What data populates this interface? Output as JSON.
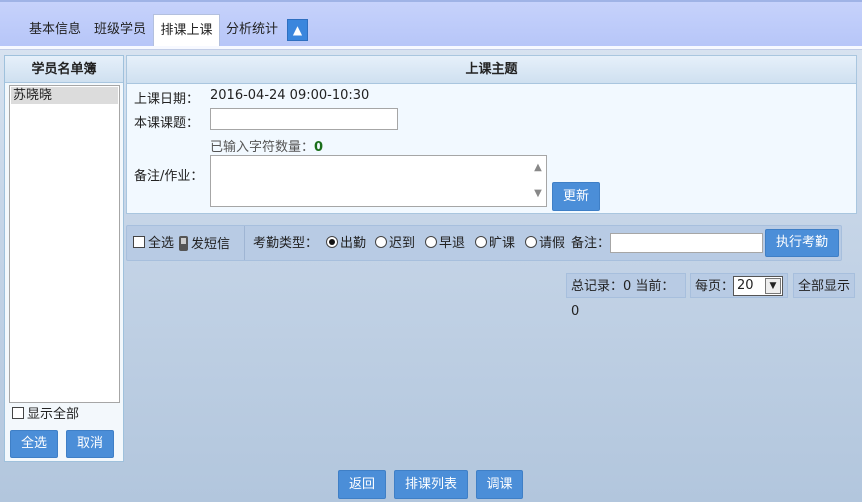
{
  "tabs": [
    {
      "label": "基本信息"
    },
    {
      "label": "班级学员"
    },
    {
      "label": "排课上课"
    },
    {
      "label": "分析统计"
    }
  ],
  "collapse_icon": "▲",
  "students_panel": {
    "title": "学员名单簿",
    "students": [
      "苏晓晓"
    ],
    "show_all_label": "显示全部",
    "select_all_label": "全选",
    "cancel_label": "取消"
  },
  "class_panel": {
    "title": "上课主题",
    "date_label": "上课日期：",
    "date_value": "2016-04-24 09:00-10:30",
    "topic_label": "本课课题：",
    "topic_value": "",
    "char_count_label": "已输入字符数量：",
    "char_count_value": "0",
    "notes_label": "备注/作业：",
    "notes_value": "",
    "update_label": "更新"
  },
  "attendance": {
    "select_all_label": "全选",
    "sms_label": "发短信",
    "type_label": "考勤类型：",
    "options": [
      "出勤",
      "迟到",
      "早退",
      "旷课",
      "请假"
    ],
    "selected": "出勤",
    "remark_label": "备注：",
    "remark_value": "",
    "execute_label": "执行考勤"
  },
  "pager": {
    "records_text": "总记录：0 当前：0",
    "per_page_label": "每页：",
    "per_page_value": "20",
    "show_all_label": "全部显示"
  },
  "footer": {
    "back_label": "返回",
    "schedule_list_label": "排课列表",
    "reschedule_label": "调课"
  }
}
